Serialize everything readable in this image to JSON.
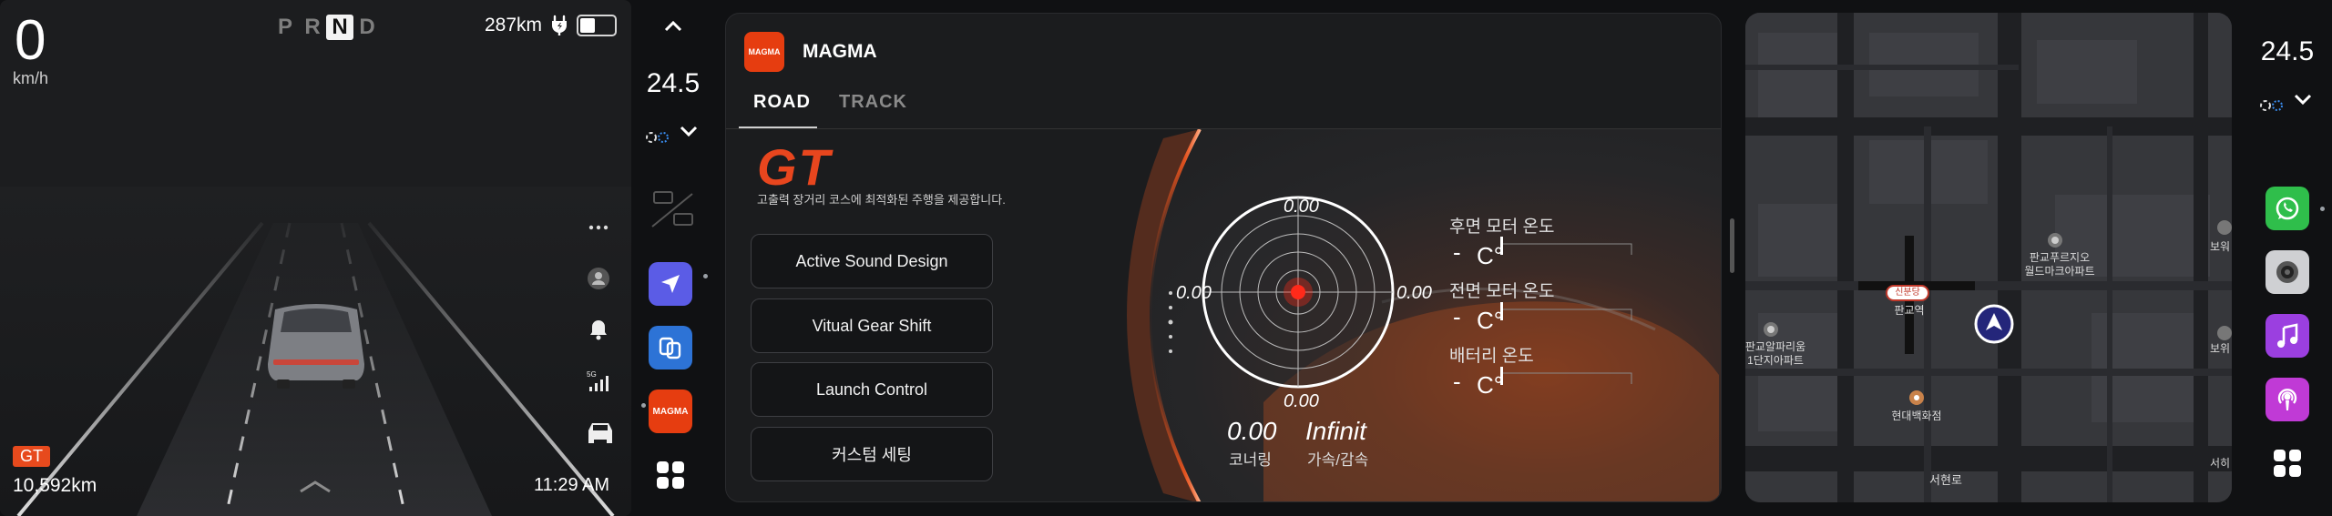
{
  "cluster": {
    "speed": "0",
    "speed_unit": "km/h",
    "gears": [
      "P",
      "R",
      "N",
      "D"
    ],
    "selected_gear": "N",
    "range": "287km",
    "drive_mode_badge": "GT",
    "odometer": "10,592km",
    "time": "11:29 AM",
    "side_icons": [
      "more-icon",
      "profile-icon",
      "bell-icon",
      "5g-signal-icon",
      "car-icon"
    ]
  },
  "climate_left": {
    "temperature": "24.5"
  },
  "climate_right": {
    "temperature": "24.5"
  },
  "dock_left": {
    "icons": [
      "rear-defrost-icon",
      "front-defrost-off-icon",
      "navigation-app-icon",
      "connectivity-app-icon",
      "magma-app-icon",
      "all-apps-icon"
    ],
    "magma_label": "MAGMA"
  },
  "dock_right": {
    "icons": [
      "whatsapp-app-icon",
      "camera-app-icon",
      "music-app-icon",
      "podcast-app-icon",
      "all-apps-icon"
    ]
  },
  "app": {
    "logo_text": "MAGMA",
    "name": "MAGMA",
    "tabs": [
      {
        "label": "ROAD",
        "active": true
      },
      {
        "label": "TRACK",
        "active": false
      }
    ],
    "mode_title": "GT",
    "mode_description": "고출력 장거리 코스에 최적화된 주행을 제공합니다.",
    "options": [
      "Active Sound Design",
      "Vitual Gear Shift",
      "Launch Control",
      "커스텀 세팅"
    ],
    "gforce": {
      "top": "0.00",
      "left": "0.00",
      "right": "0.00",
      "bottom": "0.00"
    },
    "stats": [
      {
        "value": "0.00",
        "label": "코너링"
      },
      {
        "value": "Infinit",
        "label": "가속/감속"
      }
    ],
    "temperatures": [
      {
        "label": "후면 모터 온도",
        "value": "-",
        "unit": "C°"
      },
      {
        "label": "전면 모터 온도",
        "value": "-",
        "unit": "C°"
      },
      {
        "label": "배터리 온도",
        "value": "-",
        "unit": "C°"
      }
    ],
    "accent_color": "#e8461e"
  },
  "map": {
    "labels": {
      "station_badge": "신분당",
      "station": "판교역",
      "poi_top": "판교푸르지오\n월드마크아파트",
      "poi_left": "판교알파리움\n1단지아파트",
      "poi_dept": "현대백화점",
      "road_bottom": "서현로",
      "edge_top": "보워",
      "edge_mid": "보위",
      "edge_bottom": "서히"
    }
  }
}
